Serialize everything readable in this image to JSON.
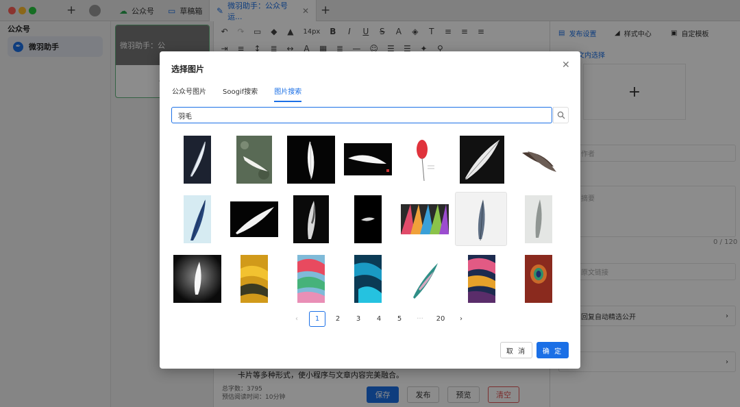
{
  "window": {
    "tabs": [
      {
        "label": "公众号",
        "icon": "cloud-icon"
      },
      {
        "label": "草稿箱",
        "icon": "folder-icon"
      },
      {
        "label": "微羽助手：公众号运...",
        "icon": "edit-icon"
      }
    ]
  },
  "sidebar": {
    "title": "公众号",
    "account": "微羽助手"
  },
  "articles": {
    "card_title": "微羽助手：公"
  },
  "toolbar": {
    "font_size": "14px"
  },
  "editor": {
    "visible_text": "卡片等多种形式，使小程序与文章内容完美融合。",
    "word_count": "总字数：3795",
    "read_time": "预估阅读时间：10分钟",
    "save": "保存",
    "publish": "发布",
    "preview": "预览",
    "clear": "清空"
  },
  "right_panel": {
    "tabs": [
      "发布设置",
      "样式中心",
      "自定模板"
    ],
    "link_text": "文内选择",
    "author_placeholder": "作者",
    "summary_placeholder": "摘要",
    "summary_count": "0 / 120",
    "source_placeholder": "原文链接",
    "comment_row": "回复自动精选公开"
  },
  "dialog": {
    "title": "选择图片",
    "tabs": [
      "公众号图片",
      "Soogif搜索",
      "图片搜索"
    ],
    "active_tab": 2,
    "search_value": "羽毛",
    "pagination": [
      "1",
      "2",
      "3",
      "4",
      "5",
      "···",
      "20"
    ],
    "current_page": "1",
    "cancel": "取 消",
    "confirm": "确 定"
  }
}
